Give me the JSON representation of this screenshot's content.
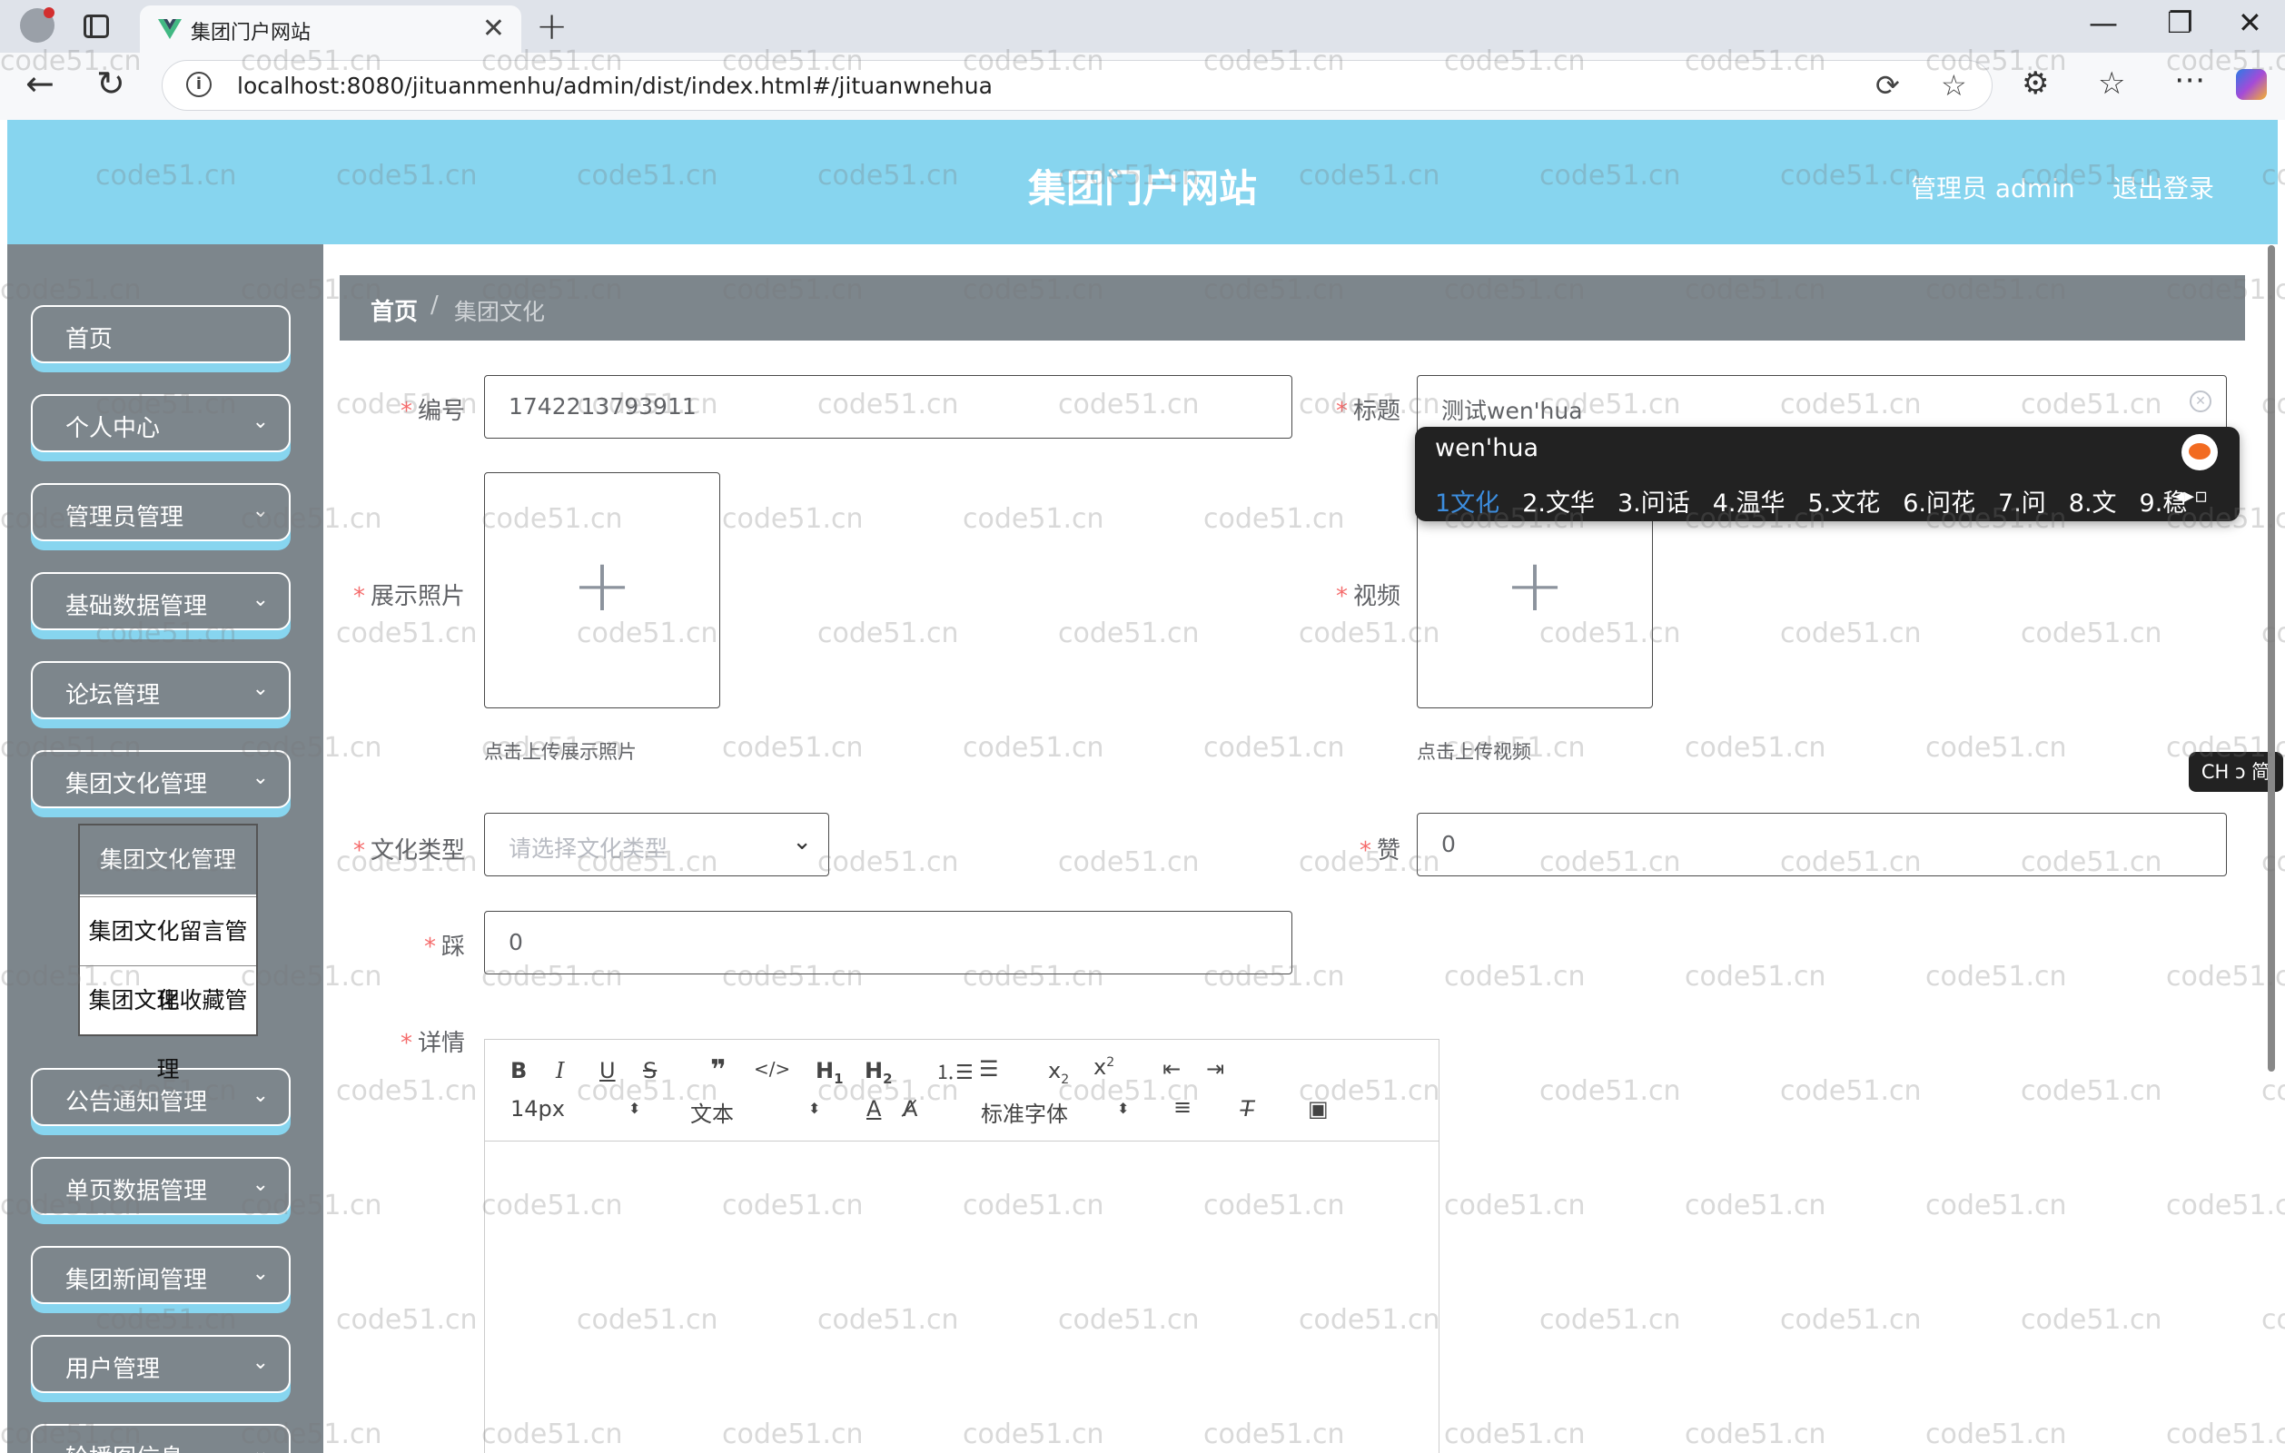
{
  "browser": {
    "tab_title": "集团门户网站",
    "url": "localhost:8080/jituanmenhu/admin/dist/index.html#/jituanwnehua",
    "new_tab_glyph": "+",
    "close_glyph": "✕"
  },
  "header": {
    "site_title": "集团门户网站",
    "user": "管理员 admin",
    "logout": "退出登录"
  },
  "sidebar": {
    "items": [
      {
        "label": "首页",
        "has_chevron": false
      },
      {
        "label": "个人中心",
        "has_chevron": true
      },
      {
        "label": "管理员管理",
        "has_chevron": true
      },
      {
        "label": "基础数据管理",
        "has_chevron": true
      },
      {
        "label": "论坛管理",
        "has_chevron": true
      },
      {
        "label": "集团文化管理",
        "has_chevron": true
      },
      {
        "label": "公告通知管理",
        "has_chevron": true
      },
      {
        "label": "单页数据管理",
        "has_chevron": true
      },
      {
        "label": "集团新闻管理",
        "has_chevron": true
      },
      {
        "label": "用户管理",
        "has_chevron": true
      },
      {
        "label": "轮播图信息",
        "has_chevron": true
      }
    ],
    "submenu": [
      "集团文化管理",
      "集团文化留言管理",
      "集团文化收藏管理"
    ]
  },
  "breadcrumb": {
    "home": "首页",
    "separator": "/",
    "current": "集团文化"
  },
  "form": {
    "code_label": "编号",
    "code_value": "1742213793911",
    "title_label": "标题",
    "title_value": "测试wen'hua",
    "photo_label": "展示照片",
    "photo_tip": "点击上传展示照片",
    "video_label": "视频",
    "video_tip": "点击上传视频",
    "type_label": "文化类型",
    "type_placeholder": "请选择文化类型",
    "like_label": "赞",
    "like_value": "0",
    "dislike_label": "踩",
    "dislike_value": "0",
    "detail_label": "详情",
    "required_mark": "*"
  },
  "editor": {
    "font_size": "14px",
    "paragraph": "文本",
    "font_family": "标准字体"
  },
  "ime": {
    "input": "wen'hua",
    "candidates": [
      "1文化",
      "2.文华",
      "3.问话",
      "4.温华",
      "5.文花",
      "6.问花",
      "7.问",
      "8.文",
      "9.稳"
    ],
    "badge": "CH ↄ 简"
  },
  "watermark": "code51.cn",
  "colors": {
    "header_bg": "#87d5ef",
    "sidebar_bg": "#7d868c",
    "required": "#f56c6c"
  }
}
